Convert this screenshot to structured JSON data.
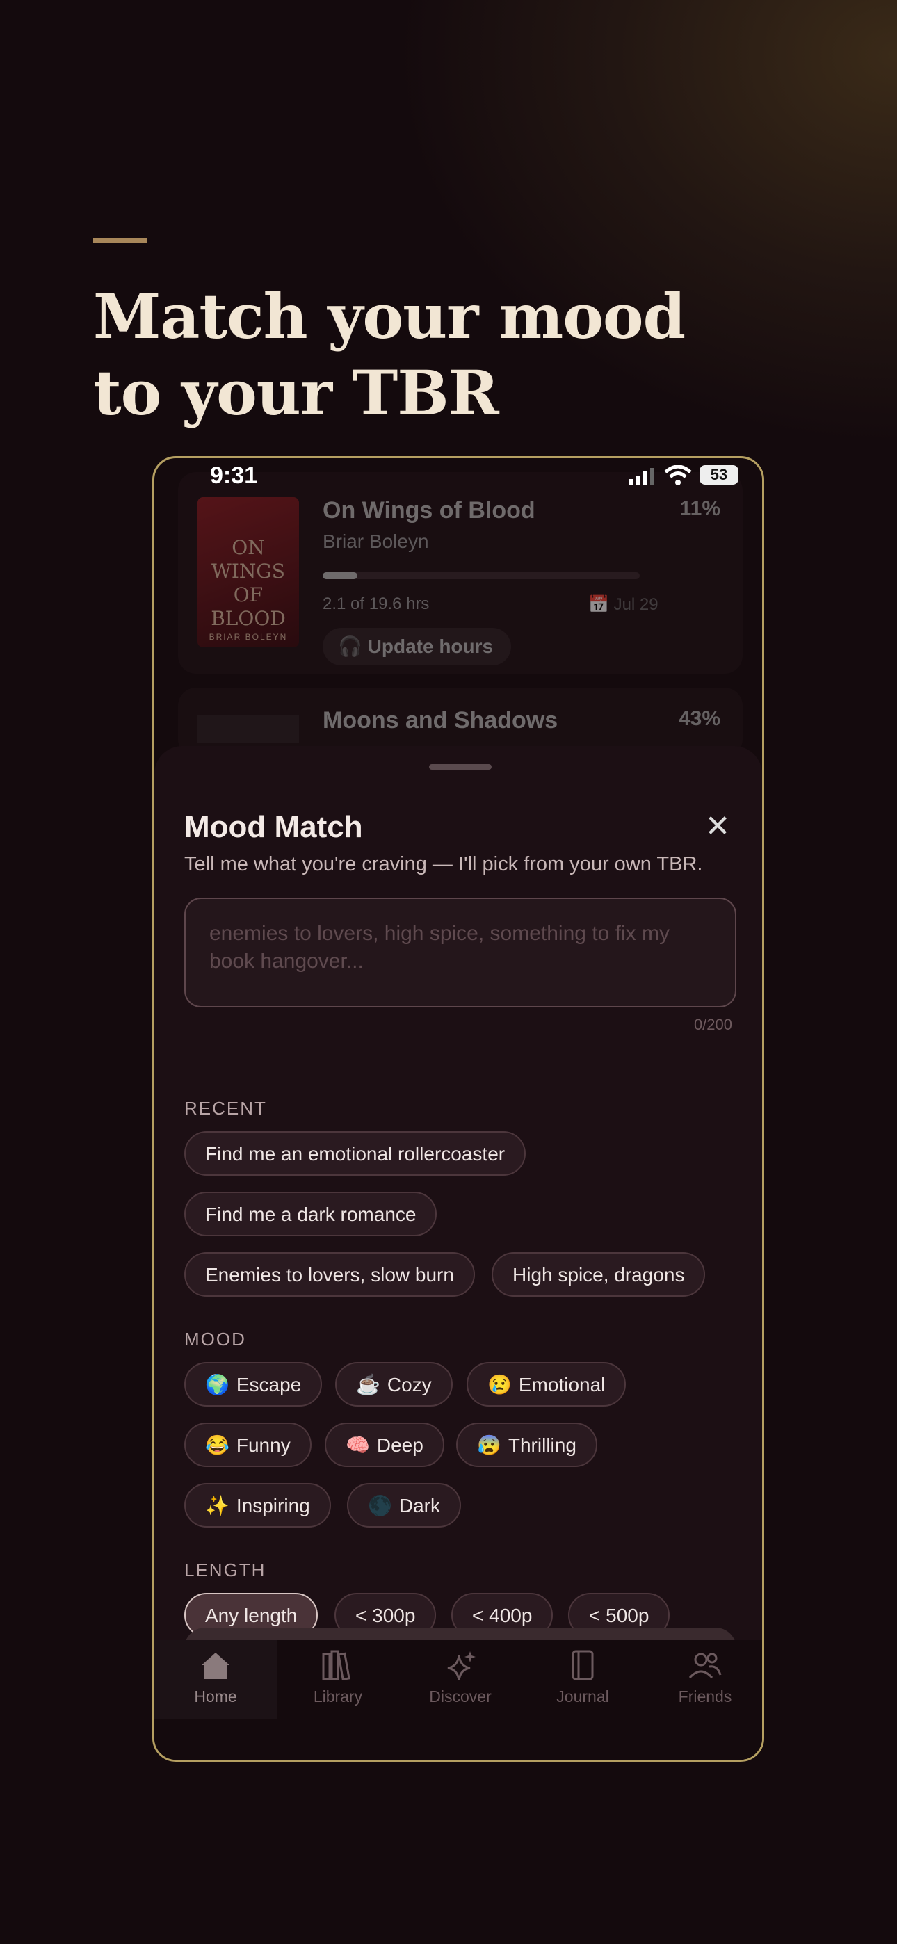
{
  "headline": {
    "line1": "Match your mood",
    "line2": "to your TBR"
  },
  "status_bar": {
    "time": "9:31",
    "battery": "53"
  },
  "books": [
    {
      "cover_title": "ON WINGS OF BLOOD",
      "cover_author": "BRIAR BOLEYN",
      "title": "On Wings of Blood",
      "author": "Briar Boleyn",
      "percent": "11%",
      "progress": 0.11,
      "hours": "2.1 of 19.6 hrs",
      "date": "Jul 29",
      "button": "Update hours"
    },
    {
      "title": "Moons and Shadows",
      "percent": "43%"
    }
  ],
  "sheet": {
    "title": "Mood Match",
    "subtitle": "Tell me what you're craving — I'll pick from your own TBR.",
    "input_placeholder": "enemies to lovers, high spice, something to fix my book hangover...",
    "counter": "0/200",
    "recent_label": "RECENT",
    "recent": [
      "Find me an emotional rollercoaster",
      "Find me a dark romance",
      "Enemies to lovers, slow burn",
      "High spice, dragons"
    ],
    "mood_label": "MOOD",
    "moods": [
      {
        "emoji": "🌍",
        "label": "Escape"
      },
      {
        "emoji": "☕",
        "label": "Cozy"
      },
      {
        "emoji": "😢",
        "label": "Emotional"
      },
      {
        "emoji": "😂",
        "label": "Funny"
      },
      {
        "emoji": "🧠",
        "label": "Deep"
      },
      {
        "emoji": "😰",
        "label": "Thrilling"
      },
      {
        "emoji": "✨",
        "label": "Inspiring"
      },
      {
        "emoji": "🌑",
        "label": "Dark"
      }
    ],
    "length_label": "LENGTH",
    "lengths": [
      "Any length",
      "< 300p",
      "< 400p",
      "< 500p"
    ],
    "selected_length": "Any length"
  },
  "tabs": [
    {
      "label": "Home",
      "icon": "home-icon"
    },
    {
      "label": "Library",
      "icon": "library-icon"
    },
    {
      "label": "Discover",
      "icon": "sparkle-icon"
    },
    {
      "label": "Journal",
      "icon": "journal-icon"
    },
    {
      "label": "Friends",
      "icon": "friends-icon"
    }
  ],
  "colors": {
    "accent": "#b59f61",
    "background": "#140a0d",
    "sheet": "#1c0f14",
    "headline": "#f2e6d4"
  }
}
